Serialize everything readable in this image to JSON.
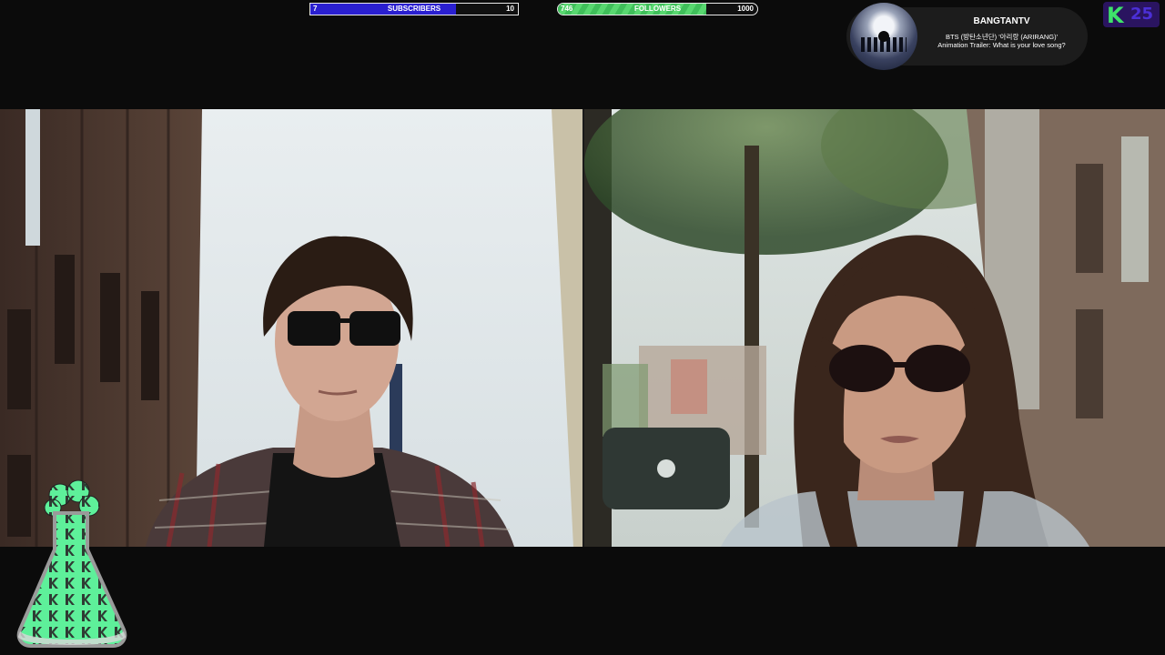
{
  "subscribers": {
    "current": "7",
    "label": "SUBSCRIBERS",
    "goal": "10",
    "progress": 0.7,
    "color": "#2a1fd0"
  },
  "followers": {
    "current": "746",
    "label": "FOLLOWERS",
    "goal": "1000",
    "progress": 0.746,
    "color": "#4cc964"
  },
  "now_playing": {
    "channel": "BANGTANTV",
    "title": "BTS (방탄소년단) '아리랑 (ARIRANG)' Animation Trailer: What is your love song?"
  },
  "logo": {
    "letter": "K",
    "number": "25",
    "accent": "#3ee36a"
  },
  "video": {
    "left_scene": "man-in-sunglasses-plaid-shirt",
    "right_scene": "woman-in-sunglasses-street"
  },
  "mascot": {
    "icon": "flask-icon",
    "color": "#5ef09a"
  }
}
